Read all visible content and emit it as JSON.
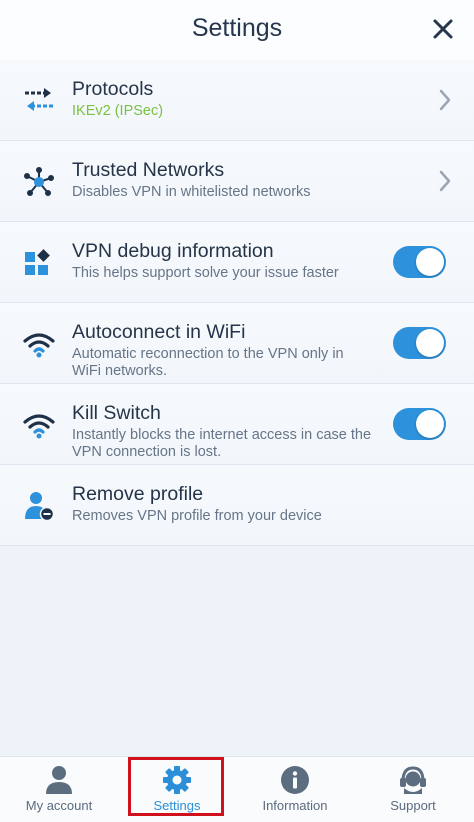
{
  "header": {
    "title": "Settings",
    "close_icon": "close-icon"
  },
  "rows": [
    {
      "label": "Protocols",
      "sub": "IKEv2 (IPSec)",
      "icon": "protocols-icon",
      "control": "chevron"
    },
    {
      "label": "Trusted Networks",
      "sub": "Disables VPN in whitelisted networks",
      "icon": "network-nodes-icon",
      "control": "chevron"
    },
    {
      "label": "VPN debug information",
      "sub": "This helps support solve your issue faster",
      "icon": "debug-blocks-icon",
      "control": "toggle",
      "on": true
    },
    {
      "label": "Autoconnect in WiFi",
      "sub": "Automatic reconnection to the VPN only in WiFi networks.",
      "icon": "wifi-icon",
      "control": "toggle",
      "on": true
    },
    {
      "label": "Kill Switch",
      "sub": "Instantly blocks the internet access in case the VPN connection is lost.",
      "icon": "wifi-icon",
      "control": "toggle",
      "on": true
    },
    {
      "label": "Remove profile",
      "sub": "Removes VPN profile from your device",
      "icon": "remove-user-icon",
      "control": "none"
    }
  ],
  "tabs": [
    {
      "label": "My account",
      "icon": "person-icon",
      "active": false
    },
    {
      "label": "Settings",
      "icon": "gear-icon",
      "active": true
    },
    {
      "label": "Information",
      "icon": "info-icon",
      "active": false
    },
    {
      "label": "Support",
      "icon": "headset-icon",
      "active": false
    }
  ],
  "colors": {
    "accent": "#2d92db",
    "protocol_green": "#7bc143",
    "highlight_red": "#d0101a",
    "background": "#eef3f9"
  }
}
